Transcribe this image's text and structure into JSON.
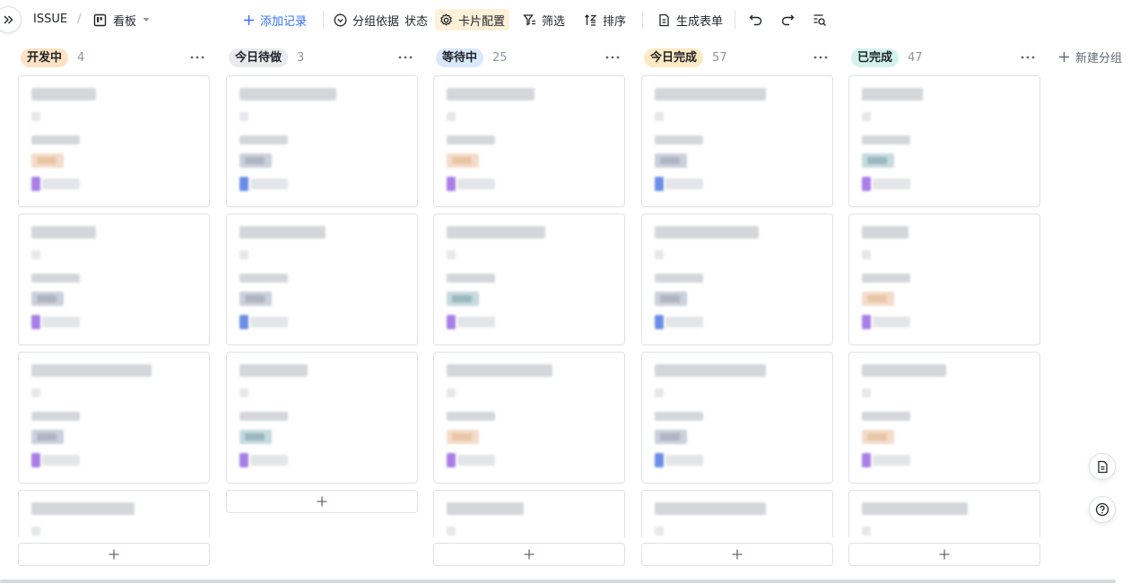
{
  "toolbar": {
    "title": "ISSUE",
    "view_name": "看板",
    "add_record": "添加记录",
    "group_by_prefix": "分组依据",
    "group_by_value": "状态",
    "card_config": "卡片配置",
    "filter": "筛选",
    "sort": "排序",
    "generate_form": "生成表单"
  },
  "columns": [
    {
      "label": "开发中",
      "count": "4",
      "badge_color": "#fde2c4",
      "cards": 4
    },
    {
      "label": "今日待做",
      "count": "3",
      "badge_color": "#e8eaed",
      "cards": 3
    },
    {
      "label": "等待中",
      "count": "25",
      "badge_color": "#d9e8fb",
      "cards": 4
    },
    {
      "label": "今日完成",
      "count": "57",
      "badge_color": "#fde9c3",
      "cards": 4
    },
    {
      "label": "已完成",
      "count": "47",
      "badge_color": "#d3f3ec",
      "cards": 4
    }
  ],
  "new_group": "新建分组",
  "add_symbol": "+",
  "colors": {
    "accent": "#3370ff",
    "border": "#dee0e3",
    "active_bg": "#fdf1d8"
  }
}
